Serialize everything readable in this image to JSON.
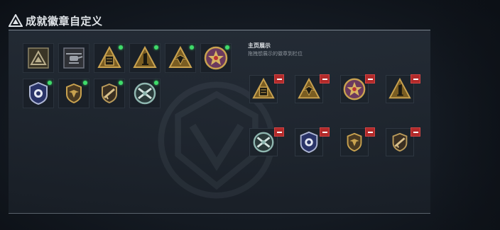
{
  "header": {
    "title": "成就徽章自定义",
    "icon": "triangle-warning-icon"
  },
  "display": {
    "title": "主页展示",
    "subtitle": "拖拽想展示的徽章到栏位"
  },
  "colors": {
    "new_dot": "#3fdc6a",
    "remove": "#b22a2a",
    "badge_gold": "#c9a24f"
  },
  "inventory": [
    {
      "icon": "triangle-mountain-badge-icon",
      "is_new": false
    },
    {
      "icon": "helicopter-badge-icon",
      "is_new": false
    },
    {
      "icon": "gold-ticket-triangle-badge-icon",
      "is_new": true
    },
    {
      "icon": "gold-number-one-triangle-badge-icon",
      "is_new": true
    },
    {
      "icon": "gold-eagle-triangle-badge-icon",
      "is_new": true
    },
    {
      "icon": "purple-star-medal-badge-icon",
      "is_new": true
    },
    {
      "icon": "police-shield-badge-icon",
      "is_new": true
    },
    {
      "icon": "winged-shield-badge-icon",
      "is_new": true
    },
    {
      "icon": "rifle-shield-badge-icon",
      "is_new": true
    },
    {
      "icon": "crossed-guns-shield-badge-icon",
      "is_new": true
    }
  ],
  "displayed": [
    {
      "icon": "gold-ticket-triangle-badge-icon"
    },
    {
      "icon": "gold-eagle-triangle-badge-icon"
    },
    {
      "icon": "purple-star-medal-badge-icon"
    },
    {
      "icon": "gold-number-one-triangle-badge-icon"
    },
    {
      "icon": "crossed-guns-shield-badge-icon"
    },
    {
      "icon": "police-shield-badge-icon"
    },
    {
      "icon": "winged-shield-badge-icon"
    },
    {
      "icon": "rifle-shield-badge-icon"
    }
  ]
}
